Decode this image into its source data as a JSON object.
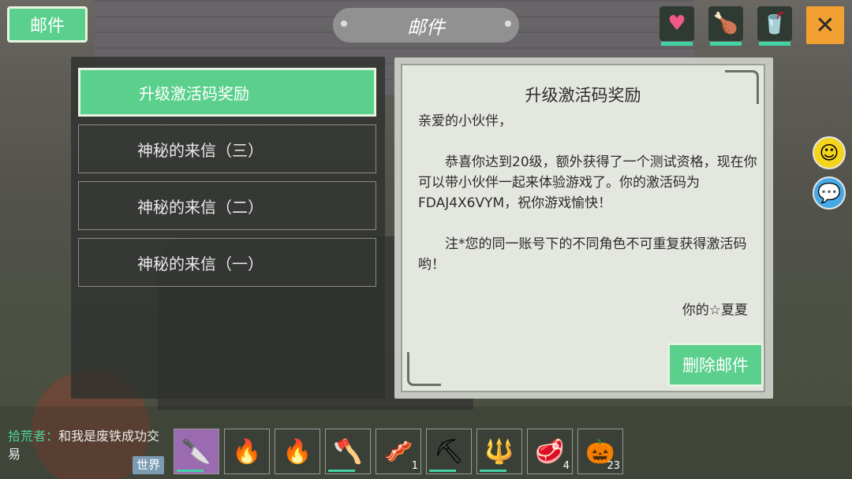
{
  "header": {
    "tab_label": "邮件",
    "title": "邮件",
    "stats": [
      {
        "icon": "heart-icon",
        "glyph": "♥",
        "color": "#f05a8a"
      },
      {
        "icon": "meat-icon",
        "glyph": "🍗",
        "color": "#f0c040"
      },
      {
        "icon": "water-cup-icon",
        "glyph": "🥤",
        "color": "#31c6b9"
      }
    ],
    "close_glyph": "✕"
  },
  "side_buttons": {
    "emoji_glyph": "☺",
    "chat_glyph": "💬"
  },
  "mail_list": [
    {
      "title": "升级激活码奖励",
      "active": true
    },
    {
      "title": "神秘的来信（三）",
      "active": false
    },
    {
      "title": "神秘的来信（二）",
      "active": false
    },
    {
      "title": "神秘的来信（一）",
      "active": false
    }
  ],
  "letter": {
    "title": "升级激活码奖励",
    "greeting": "亲爱的小伙伴，",
    "paragraph1": "恭喜你达到20级，额外获得了一个测试资格，现在你可以带小伙伴一起来体验游戏了。你的激活码为FDAJ4X6VYM，祝你游戏愉快！",
    "paragraph2": "注*您的同一账号下的不同角色不可重复获得激活码哟！",
    "signature": "你的☆夏夏",
    "delete_label": "删除邮件"
  },
  "chat": {
    "name": "拾荒者：",
    "message": "和我是废铁成功交易",
    "channel": "世界"
  },
  "hotbar": [
    {
      "icon": "knife-icon",
      "glyph": "🔪",
      "count": "",
      "selected": true
    },
    {
      "icon": "campfire-icon",
      "glyph": "🔥",
      "count": "",
      "selected": false
    },
    {
      "icon": "campfire-icon",
      "glyph": "🔥",
      "count": "",
      "selected": false
    },
    {
      "icon": "axe-icon",
      "glyph": "🪓",
      "count": "",
      "selected": false
    },
    {
      "icon": "raw-meat-icon",
      "glyph": "🥓",
      "count": "1",
      "selected": false
    },
    {
      "icon": "pickaxe-icon",
      "glyph": "⛏",
      "count": "",
      "selected": false
    },
    {
      "icon": "spear-icon",
      "glyph": "🔱",
      "count": "",
      "selected": false
    },
    {
      "icon": "steak-icon",
      "glyph": "🥩",
      "count": "4",
      "selected": false
    },
    {
      "icon": "pumpkin-icon",
      "glyph": "🎃",
      "count": "23",
      "selected": false
    }
  ]
}
